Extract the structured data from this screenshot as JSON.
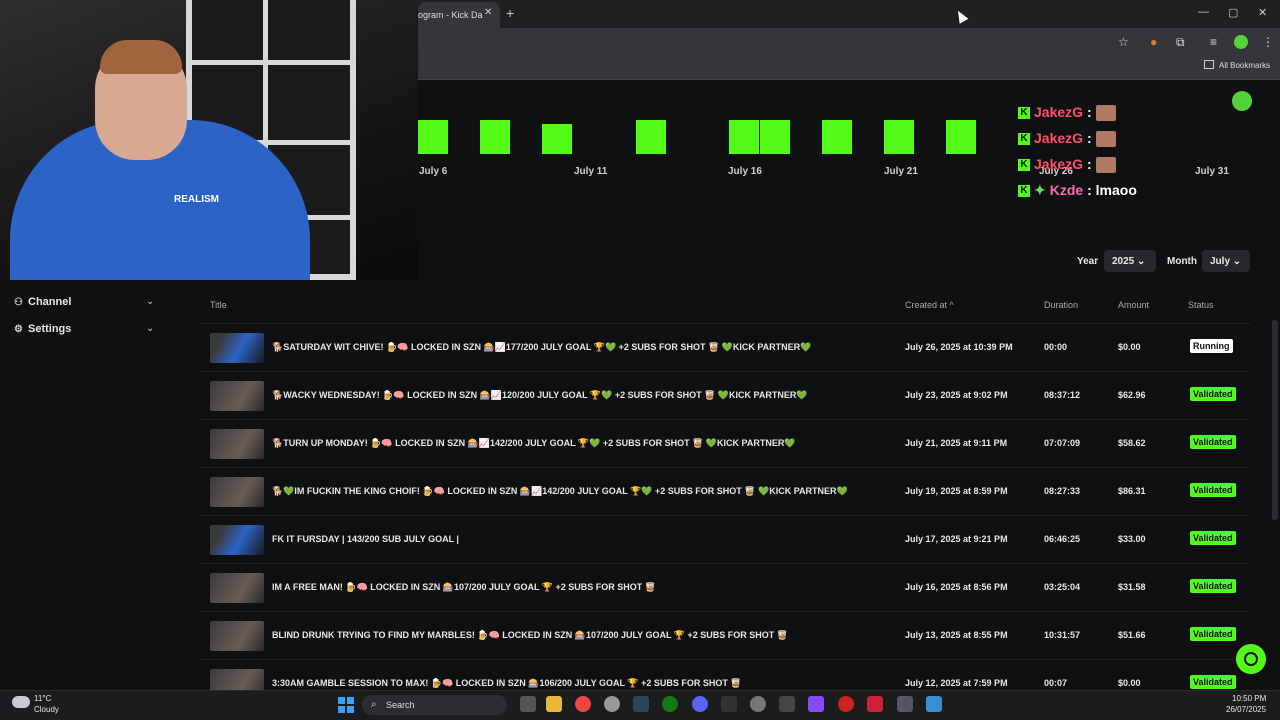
{
  "browser": {
    "tab_title": "ogram - Kick Da",
    "tab_close": "✕",
    "new_tab": "+",
    "window_controls": [
      "—",
      "▢",
      "✕"
    ],
    "all_bookmarks": "All Bookmarks"
  },
  "webcam": {
    "shirt_text": "REALISM"
  },
  "chart_data": {
    "type": "bar",
    "x_ticks": [
      "July 6",
      "July 11",
      "July 16",
      "July 21",
      "July 26",
      "July 31"
    ],
    "note_values": "bar heights cropped at top of viewport"
  },
  "chat": {
    "messages": [
      {
        "user": "JakezG",
        "sep": ":",
        "text": "",
        "emote": true,
        "badge": "K"
      },
      {
        "user": "JakezG",
        "sep": ":",
        "text": "",
        "emote": true,
        "badge": "K"
      },
      {
        "user": "JakezG",
        "sep": ":",
        "text": "",
        "emote": true,
        "badge": "K"
      },
      {
        "user": "Kzde",
        "sep": ":",
        "text": "lmaoo",
        "emote": false,
        "badge": "K"
      }
    ]
  },
  "filters": {
    "year_label": "Year",
    "year_value": "2025",
    "month_label": "Month",
    "month_value": "July"
  },
  "sidebar": {
    "items": [
      {
        "label": "Channel"
      },
      {
        "label": "Settings"
      }
    ]
  },
  "table": {
    "headers": {
      "title": "Title",
      "created_at": "Created at ^",
      "duration": "Duration",
      "amount": "Amount",
      "status": "Status"
    },
    "rows": [
      {
        "title": "🐕SATURDAY WIT CHIVE! 🍺🧠 LOCKED IN SZN 🎰📈177/200 JULY GOAL 🏆💚 +2 SUBS FOR SHOT 🥃 💚KICK PARTNER💚",
        "created": "July 26, 2025 at 10:39 PM",
        "duration": "00:00",
        "amount": "$0.00",
        "status": "Running"
      },
      {
        "title": "🐕WACKY WEDNESDAY! 🍺🧠 LOCKED IN SZN 🎰📈120/200 JULY GOAL 🏆💚 +2 SUBS FOR SHOT 🥃 💚KICK PARTNER💚",
        "created": "July 23, 2025 at 9:02 PM",
        "duration": "08:37:12",
        "amount": "$62.96",
        "status": "Validated"
      },
      {
        "title": "🐕TURN UP MONDAY! 🍺🧠 LOCKED IN SZN 🎰📈142/200 JULY GOAL 🏆💚 +2 SUBS FOR SHOT 🥃 💚KICK PARTNER💚",
        "created": "July 21, 2025 at 9:11 PM",
        "duration": "07:07:09",
        "amount": "$58.62",
        "status": "Validated"
      },
      {
        "title": "🐕💚IM FUCKIN THE KING CHOIF! 🍺🧠 LOCKED IN SZN 🎰📈142/200 JULY GOAL 🏆💚 +2 SUBS FOR SHOT 🥃 💚KICK PARTNER💚",
        "created": "July 19, 2025 at 8:59 PM",
        "duration": "08:27:33",
        "amount": "$86.31",
        "status": "Validated"
      },
      {
        "title": "FK IT FURSDAY | 143/200 SUB JULY GOAL |",
        "created": "July 17, 2025 at 9:21 PM",
        "duration": "06:46:25",
        "amount": "$33.00",
        "status": "Validated"
      },
      {
        "title": "IM A FREE MAN! 🍺🧠 LOCKED IN SZN 🎰107/200 JULY GOAL 🏆 +2 SUBS FOR SHOT 🥃",
        "created": "July 16, 2025 at 8:56 PM",
        "duration": "03:25:04",
        "amount": "$31.58",
        "status": "Validated"
      },
      {
        "title": "BLIND DRUNK TRYING TO FIND MY MARBLES! 🍺🧠 LOCKED IN SZN 🎰107/200 JULY GOAL 🏆 +2 SUBS FOR SHOT 🥃",
        "created": "July 13, 2025 at 8:55 PM",
        "duration": "10:31:57",
        "amount": "$51.66",
        "status": "Validated"
      },
      {
        "title": "3:30AM GAMBLE SESSION TO MAX! 🍺🧠 LOCKED IN SZN 🎰106/200 JULY GOAL 🏆 +2 SUBS FOR SHOT 🥃",
        "created": "July 12, 2025 at 7:59 PM",
        "duration": "00:07",
        "amount": "$0.00",
        "status": "Validated"
      }
    ]
  },
  "taskbar": {
    "weather_temp": "11°C",
    "weather_cond": "Cloudy",
    "search_label": "Search",
    "time": "10:50 PM",
    "date": "26/07/2025"
  },
  "colors": {
    "accent": "#53fc18",
    "background": "#0f1011",
    "chat_name": "#ff4d6a"
  }
}
